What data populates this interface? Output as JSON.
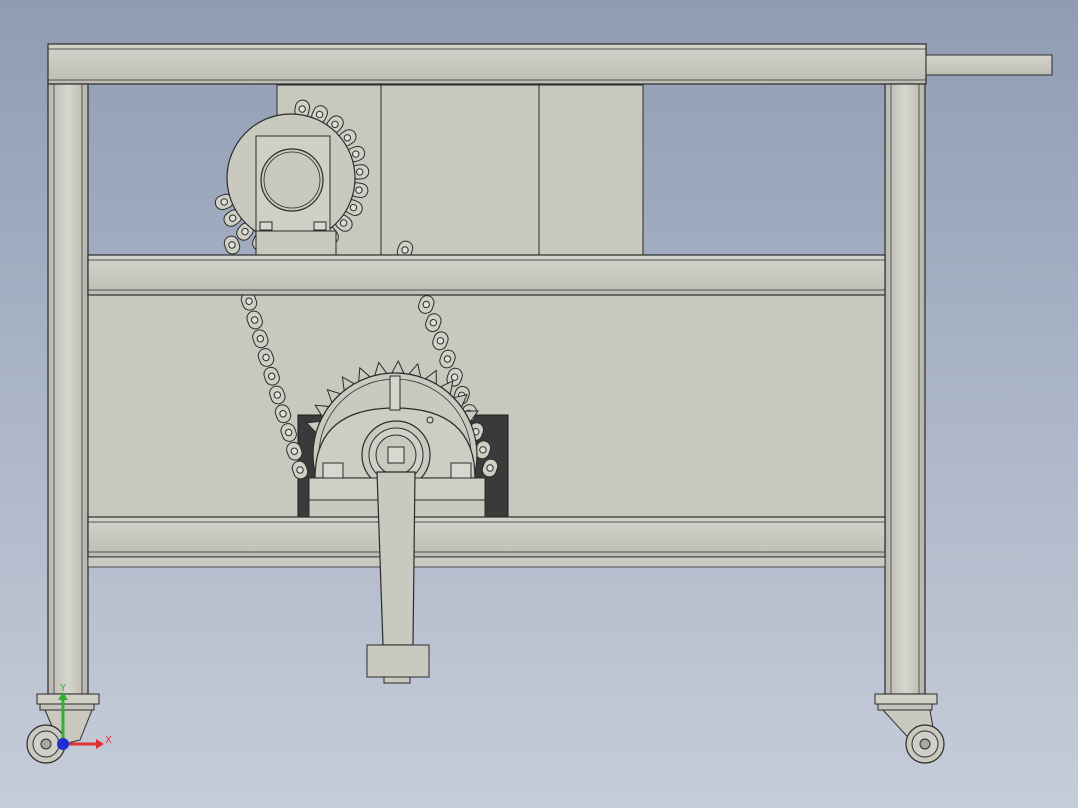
{
  "viewport": {
    "background_top": "#8f9cb2",
    "background_bottom": "#c6ccd9",
    "part_color": "#c9c9c0",
    "edge_color": "#2b2b2b",
    "dark_plate_color": "#3a3a3a"
  },
  "triad": {
    "x_label": "X",
    "y_label": "Y",
    "x_color": "#e03030",
    "y_color": "#30b030",
    "z_color": "#2030d0"
  }
}
